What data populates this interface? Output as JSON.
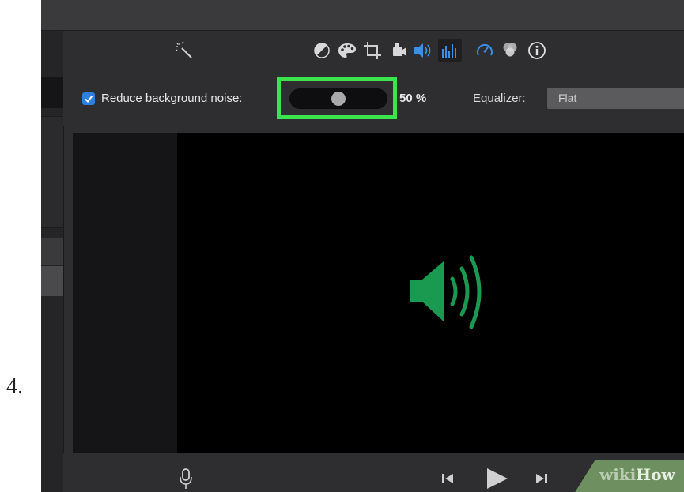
{
  "step_number": "4.",
  "toolbar": {
    "tools": [
      {
        "name": "enhance-wand-icon"
      },
      {
        "name": "color-balance-icon"
      },
      {
        "name": "color-correction-palette-icon"
      },
      {
        "name": "crop-icon"
      },
      {
        "name": "stabilization-camera-icon"
      },
      {
        "name": "volume-icon"
      },
      {
        "name": "noise-reduction-equalizer-icon",
        "selected": true
      },
      {
        "name": "speed-icon"
      },
      {
        "name": "clip-filter-icon"
      },
      {
        "name": "info-icon"
      }
    ],
    "accent_color": "#3a8fe8"
  },
  "noise": {
    "checkbox_label": "Reduce background noise:",
    "checked": true,
    "slider_value_percent": 50,
    "value_text": "50 %"
  },
  "equalizer": {
    "label": "Equalizer:",
    "selected": "Flat"
  },
  "viewer": {
    "icon": "speaker-audio-icon",
    "icon_color": "#1a9a50"
  },
  "playback": {
    "icons": [
      "microphone-icon",
      "skip-back-icon",
      "play-icon",
      "skip-forward-icon"
    ]
  },
  "watermark": {
    "part1": "wiki",
    "part2": "How"
  },
  "highlight_color": "#3be44a"
}
